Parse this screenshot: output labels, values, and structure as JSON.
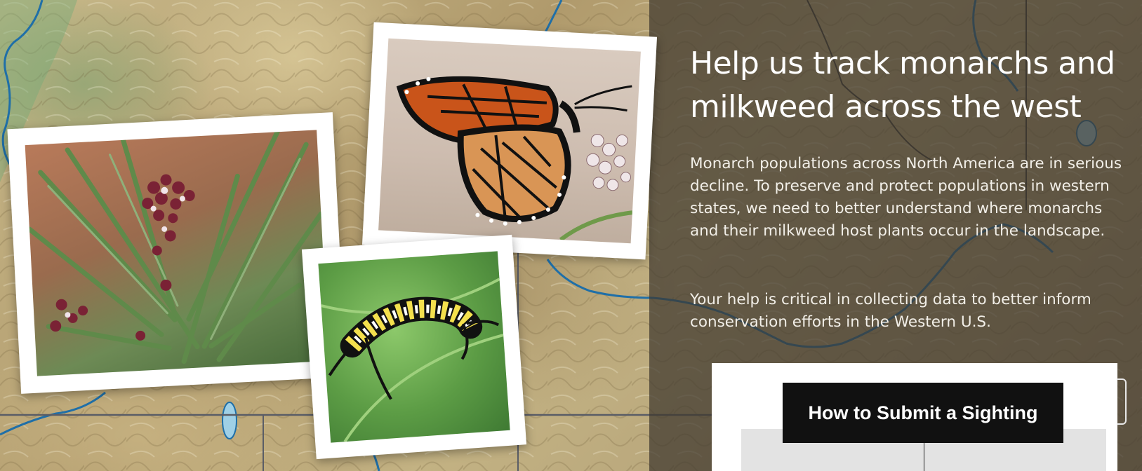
{
  "hero": {
    "headline": "Help us track monarchs and milkweed across the west",
    "paragraph_1": "Monarch populations across North America are in serious decline. To preserve and protect populations in western states, we need to better understand where monarchs and their milkweed host plants occur in the landscape.",
    "paragraph_2": "Your help is critical in collecting data to better inform conservation efforts in the Western U.S."
  },
  "photos": [
    {
      "subject": "milkweed-flowers"
    },
    {
      "subject": "monarch-butterfly"
    },
    {
      "subject": "monarch-caterpillar"
    }
  ],
  "card": {
    "button_label": "How to Submit a Sighting"
  },
  "colors": {
    "overlay": "#3e382e",
    "river": "#1f6fa8",
    "button_bg": "#111111",
    "headline_text": "#ffffff"
  }
}
